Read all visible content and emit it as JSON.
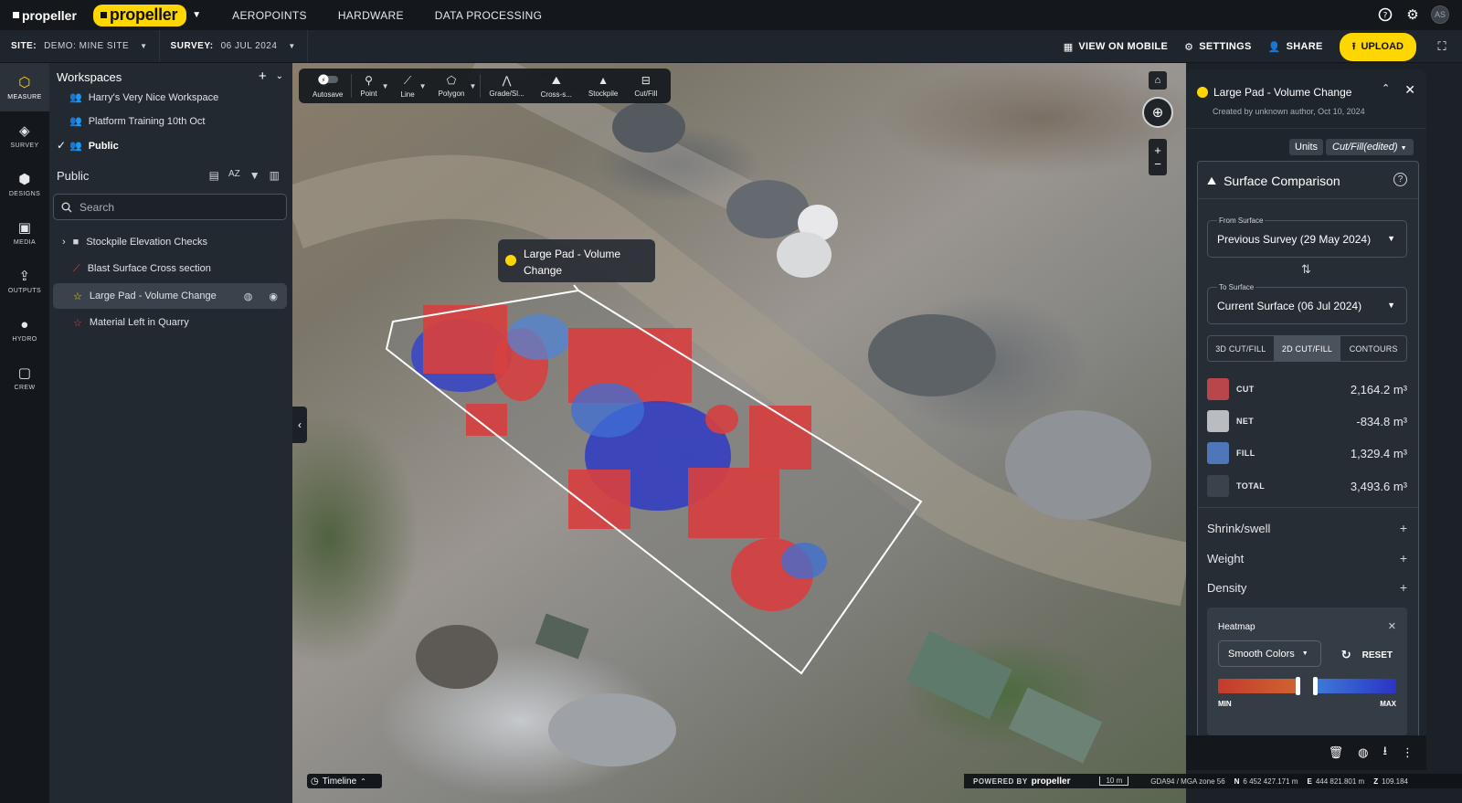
{
  "topnav": {
    "brand": "propeller",
    "product": "propeller",
    "links": [
      "AEROPOINTS",
      "HARDWARE",
      "DATA PROCESSING"
    ],
    "avatar": "AS"
  },
  "subbar": {
    "site_label": "SITE:",
    "site_value": "DEMO: MINE SITE",
    "survey_label": "SURVEY:",
    "survey_value": "06 JUL 2024",
    "view_mobile": "VIEW ON MOBILE",
    "settings": "SETTINGS",
    "share": "SHARE",
    "upload": "UPLOAD"
  },
  "rail": [
    "MEASURE",
    "SURVEY",
    "DESIGNS",
    "MEDIA",
    "OUTPUTS",
    "HYDRO",
    "CREW"
  ],
  "workspaces": {
    "title": "Workspaces",
    "items": [
      "Harry's Very Nice Workspace",
      "Platform Training 10th Oct",
      "Public"
    ]
  },
  "public": {
    "title": "Public",
    "search_placeholder": "Search",
    "layers": [
      "Stockpile Elevation Checks",
      "Blast Surface Cross section",
      "Large Pad - Volume Change",
      "Material Left in Quarry"
    ]
  },
  "tools": [
    "Autosave",
    "Point",
    "Line",
    "Polygon",
    "Grade/Sl...",
    "Cross-s...",
    "Stockpile",
    "Cut/Fill"
  ],
  "tooltip": "Large Pad - Volume Change",
  "timeline": "Timeline",
  "map_footer": {
    "powered": "POWERED BY",
    "brand": "propeller",
    "scale": "10 m",
    "crs": "GDA94 / MGA zone 56",
    "n_label": "N",
    "n_value": "6 452 427.171 m",
    "e_label": "E",
    "e_value": "444 821.801 m",
    "z_label": "Z",
    "z_value": "109.184"
  },
  "panel": {
    "title": "Large Pad - Volume Change",
    "subtitle": "Created by unknown author, Oct 10, 2024",
    "units": "Units",
    "mode": "Cut/Fill(edited)",
    "section": "Surface Comparison",
    "from_label": "From Surface",
    "from_value": "Previous Survey (29 May 2024)",
    "to_label": "To Surface",
    "to_value": "Current Surface (06 Jul 2024)",
    "tabs": [
      "3D CUT/FILL",
      "2D CUT/FILL",
      "CONTOURS"
    ],
    "values": [
      {
        "name": "CUT",
        "value": "2,164.2 m³",
        "color": "#b8464a"
      },
      {
        "name": "NET",
        "value": "-834.8 m³",
        "color": "#b9bcc0"
      },
      {
        "name": "FILL",
        "value": "1,329.4 m³",
        "color": "#4f76b8"
      },
      {
        "name": "TOTAL",
        "value": "3,493.6 m³",
        "color": "#3a424b"
      }
    ],
    "expanders": [
      "Shrink/swell",
      "Weight",
      "Density"
    ],
    "heatmap": {
      "title": "Heatmap",
      "select": "Smooth Colors",
      "reset": "RESET",
      "min": "MIN",
      "max": "MAX"
    }
  }
}
